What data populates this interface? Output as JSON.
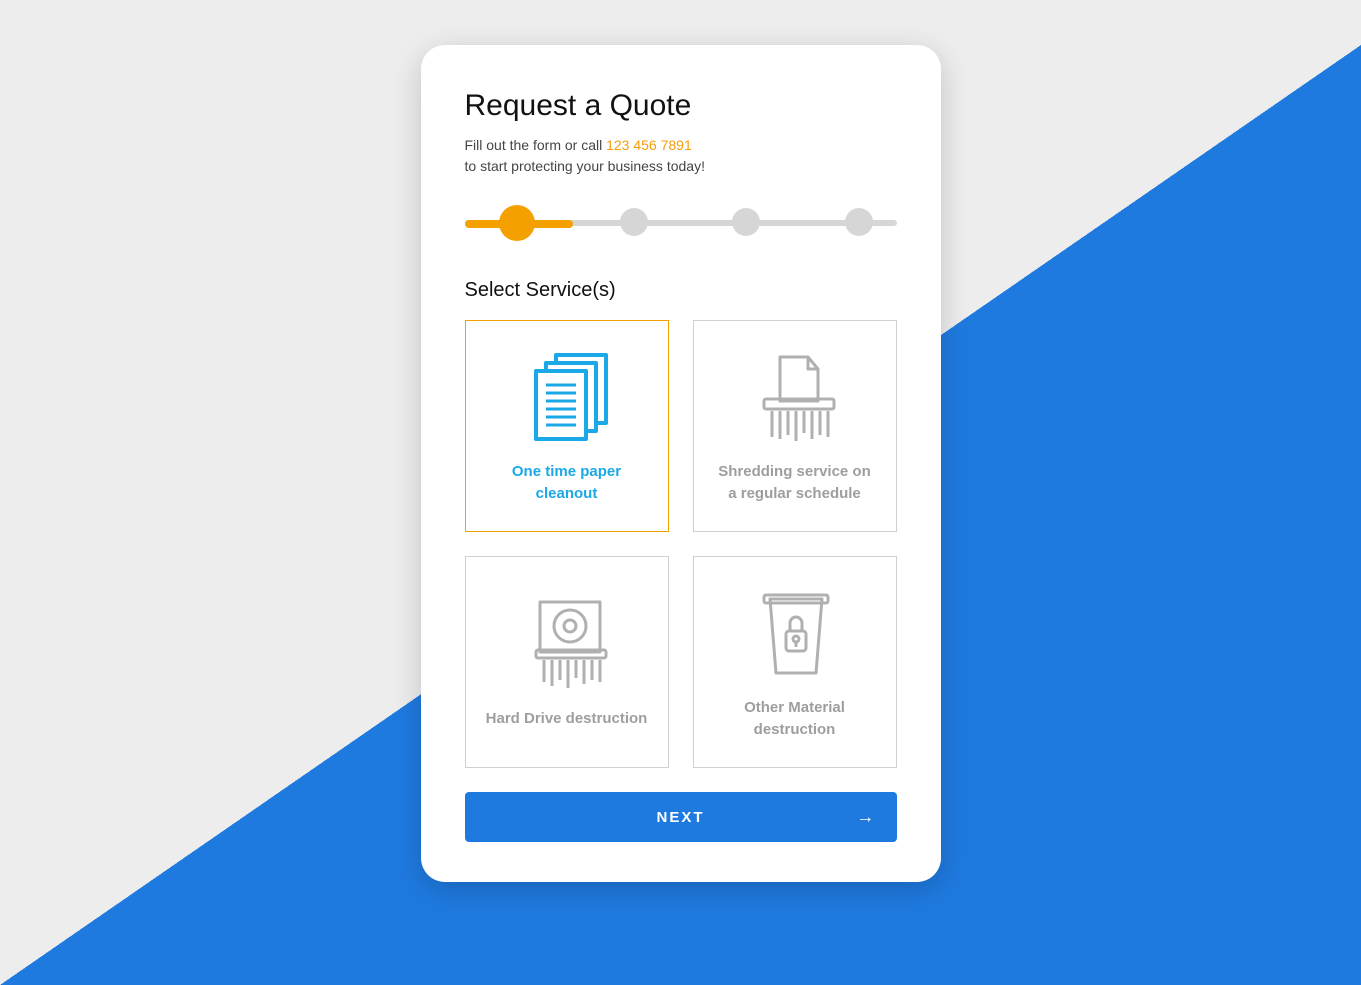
{
  "colors": {
    "accent_blue": "#1f7ae0",
    "accent_orange": "#f4a100",
    "accent_cyan": "#1ba8e6",
    "grey_bg": "#ededed",
    "grey_text": "#9e9e9e"
  },
  "header": {
    "title": "Request a Quote",
    "subtitle_prefix": "Fill out the form or call ",
    "phone": "123 456 7891",
    "subtitle_line2": "to start protecting your business today!"
  },
  "progress": {
    "current_step": 1,
    "total_steps": 4,
    "fill_percent": 25
  },
  "services": {
    "section_title": "Select Service(s)",
    "options": [
      {
        "id": "one-time-paper",
        "label": "One time paper cleanout",
        "selected": true
      },
      {
        "id": "regular-shredding",
        "label": "Shredding service on a regular schedule",
        "selected": false
      },
      {
        "id": "hard-drive",
        "label": "Hard Drive destruction",
        "selected": false
      },
      {
        "id": "other-material",
        "label": "Other Material destruction",
        "selected": false
      }
    ]
  },
  "actions": {
    "next_label": "NEXT"
  }
}
